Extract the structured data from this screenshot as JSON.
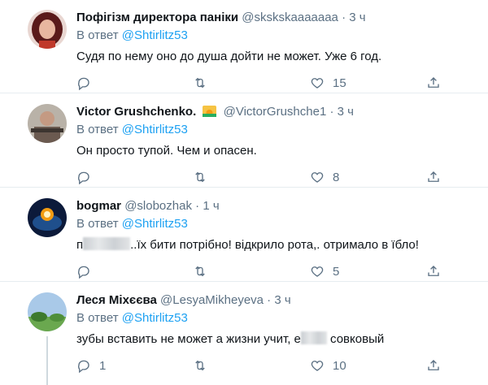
{
  "reply_prefix": "В ответ",
  "tweets": [
    {
      "name": "Пофігізм директора паніки",
      "handle": "@skskskaaaaaaa",
      "time": "3 ч",
      "mention": "@Shtirlitz53",
      "text": "Судя по нему оно до душа дойти не может. Уже 6 год.",
      "text_after": "",
      "likes": "15",
      "replies": "",
      "avatar_color": "#c0392b"
    },
    {
      "name": "Victor Grushchenko.",
      "handle": "@VictorGrushche1",
      "time": "3 ч",
      "mention": "@Shtirlitz53",
      "text": "Он просто тупой. Чем и опасен.",
      "text_after": "",
      "likes": "8",
      "replies": "",
      "avatar_color": "#8a6d5a"
    },
    {
      "name": "bogmar",
      "handle": "@slobozhak",
      "time": "1 ч",
      "mention": "@Shtirlitz53",
      "text": "п",
      "text_after": "..їх бити потрібно! відкрило рота,. отримало в їбло!",
      "likes": "5",
      "replies": "",
      "avatar_color": "#1f4f8c"
    },
    {
      "name": "Леся Міхєєва",
      "handle": "@LesyaMikheyeva",
      "time": "3 ч",
      "mention": "@Shtirlitz53",
      "text": "зубы вставить не может а жизни учит, е",
      "text_after": " совковый",
      "likes": "10",
      "replies": "1",
      "avatar_color": "#6aa84f"
    }
  ],
  "separator": "·",
  "icons": [
    "reply-icon",
    "retweet-icon",
    "like-icon",
    "share-icon",
    "sun-badge-icon"
  ]
}
